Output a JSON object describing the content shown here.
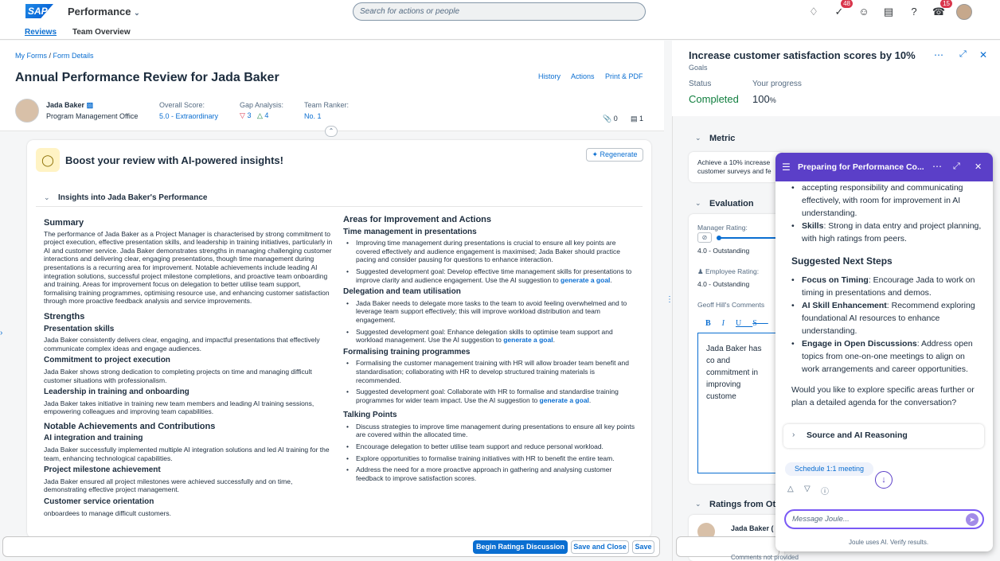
{
  "shell": {
    "logo": "SAP",
    "app_title": "Performance",
    "search_placeholder": "Search for actions or people",
    "todo_badge": "48",
    "notif_badge": "15",
    "tabs": [
      "Reviews",
      "Team Overview"
    ]
  },
  "form": {
    "breadcrumb_1": "My Forms",
    "breadcrumb_sep": " / ",
    "breadcrumb_2": "Form Details",
    "title": "Annual Performance Review for Jada Baker",
    "actions": [
      "History",
      "Actions",
      "Print & PDF"
    ],
    "employee_name": "Jada Baker",
    "employee_dept": "Program Management Office",
    "overall_label": "Overall Score:",
    "overall_value": "5.0 - Extraordinary",
    "gap_label": "Gap Analysis:",
    "gap_down": "3",
    "gap_up": "4",
    "ranker_label": "Team Ranker:",
    "ranker_value": "No. 1",
    "attach_count": "0",
    "comment_count": "1"
  },
  "insights": {
    "boost_title": "Boost your review with AI-powered insights!",
    "regenerate": "Regenerate",
    "section_title": "Insights into Jada Baker's Performance",
    "summary_h": "Summary",
    "summary": "The performance of Jada Baker as a Project Manager is characterised by strong commitment to project execution, effective presentation skills, and leadership in training initiatives, particularly in AI and customer service. Jada Baker demonstrates strengths in managing challenging customer interactions and delivering clear, engaging presentations, though time management during presentations is a recurring area for improvement. Notable achievements include leading AI integration solutions, successful project milestone completions, and proactive team onboarding and training. Areas for improvement focus on delegation to better utilise team support, formalising training programmes, optimising resource use, and enhancing customer satisfaction through more proactive feedback analysis and service improvements.",
    "strengths_h": "Strengths",
    "s1_h": "Presentation skills",
    "s1": "Jada Baker consistently delivers clear, engaging, and impactful presentations that effectively communicate complex ideas and engage audiences.",
    "s2_h": "Commitment to project execution",
    "s2": "Jada Baker shows strong dedication to completing projects on time and managing difficult customer situations with professionalism.",
    "s3_h": "Leadership in training and onboarding",
    "s3": "Jada Baker takes initiative in training new team members and leading AI training sessions, empowering colleagues and improving team capabilities.",
    "ach_h": "Notable Achievements and Contributions",
    "a1_h": "AI integration and training",
    "a1": "Jada Baker successfully implemented multiple AI integration solutions and led AI training for the team, enhancing technological capabilities.",
    "a2_h": "Project milestone achievement",
    "a2": "Jada Baker ensured all project milestones were achieved successfully and on time, demonstrating effective project management.",
    "a3_h": "Customer service orientation",
    "a3": "onboardees to manage difficult customers.",
    "improve_h": "Areas for Improvement and Actions",
    "i1_h": "Time management in presentations",
    "i1_b1": "Improving time management during presentations is crucial to ensure all key points are covered effectively and audience engagement is maximised; Jada Baker should practice pacing and consider pausing for questions to enhance interaction.",
    "i1_b2": "Suggested development goal: Develop effective time management skills for presentations to improve clarity and audience engagement. Use the AI suggestion to ",
    "i2_h": "Delegation and team utilisation",
    "i2_b1": "Jada Baker needs to delegate more tasks to the team to avoid feeling overwhelmed and to leverage team support effectively; this will improve workload distribution and team engagement.",
    "i2_b2": "Suggested development goal: Enhance delegation skills to optimise team support and workload management. Use the AI suggestion to ",
    "i3_h": "Formalising training programmes",
    "i3_b1": "Formalising the customer management training with HR will allow broader team benefit and standardisation; collaborating with HR to develop structured training materials is recommended.",
    "i3_b2": "Suggested development goal: Collaborate with HR to formalise and standardise training programmes for wider team impact. Use the AI suggestion to ",
    "gen_link": "generate a goal",
    "talk_h": "Talking Points",
    "t1": "Discuss strategies to improve time management during presentations to ensure all key points are covered within the allocated time.",
    "t2": "Encourage delegation to better utilise team support and reduce personal workload.",
    "t3": "Explore opportunities to formalise training initiatives with HR to benefit the entire team.",
    "t4": "Address the need for a more proactive approach in gathering and analysing customer feedback to improve satisfaction scores."
  },
  "footer": {
    "begin": "Begin Ratings Discussion",
    "save_close": "Save and Close",
    "save": "Save"
  },
  "goal": {
    "title": "Increase customer satisfaction scores by 10%",
    "subtitle": "Goals",
    "status_label": "Status",
    "status_value": "Completed",
    "progress_label": "Your progress",
    "progress_value": "100",
    "progress_unit": "%",
    "metric_h": "Metric",
    "metric_text": "Achieve a 10% increase",
    "metric_text2": "customer surveys and fe",
    "eval_h": "Evaluation",
    "mgr_label": "Manager Rating:",
    "mgr_value": "4.0 - Outstanding",
    "emp_label": "Employee Rating:",
    "emp_value": "4.0 - Outstanding",
    "comments_label": "Geoff Hill's Comments",
    "comment_text": "Jada Baker has co and commitment in improving custome",
    "ratings_h": "Ratings from Oth",
    "rater": "Jada Baker (",
    "rater_note": "Comments not provided"
  },
  "joule": {
    "title": "Preparing for Performance Co...",
    "intro": "accepting responsibility and communicating effectively, with room for improvement in AI understanding.",
    "skills_b": "Skills",
    "skills": ": Strong in data entry and project planning, with high ratings from peers.",
    "next_h": "Suggested Next Steps",
    "n1_b": "Focus on Timing",
    "n1": ": Encourage Jada to work on timing in presentations and demos.",
    "n2_b": "AI Skill Enhancement",
    "n2": ": Recommend exploring foundational AI resources to enhance understanding.",
    "n3_b": "Engage in Open Discussions",
    "n3": ": Address open topics from one-on-one meetings to align on work arrangements and career opportunities.",
    "question": "Would you like to explore specific areas further or plan a detailed agenda for the conversation?",
    "source": "Source and AI Reasoning",
    "schedule": "Schedule 1:1 meeting",
    "message_placeholder": "Message Joule...",
    "disclaimer": "Joule uses AI. Verify results."
  }
}
